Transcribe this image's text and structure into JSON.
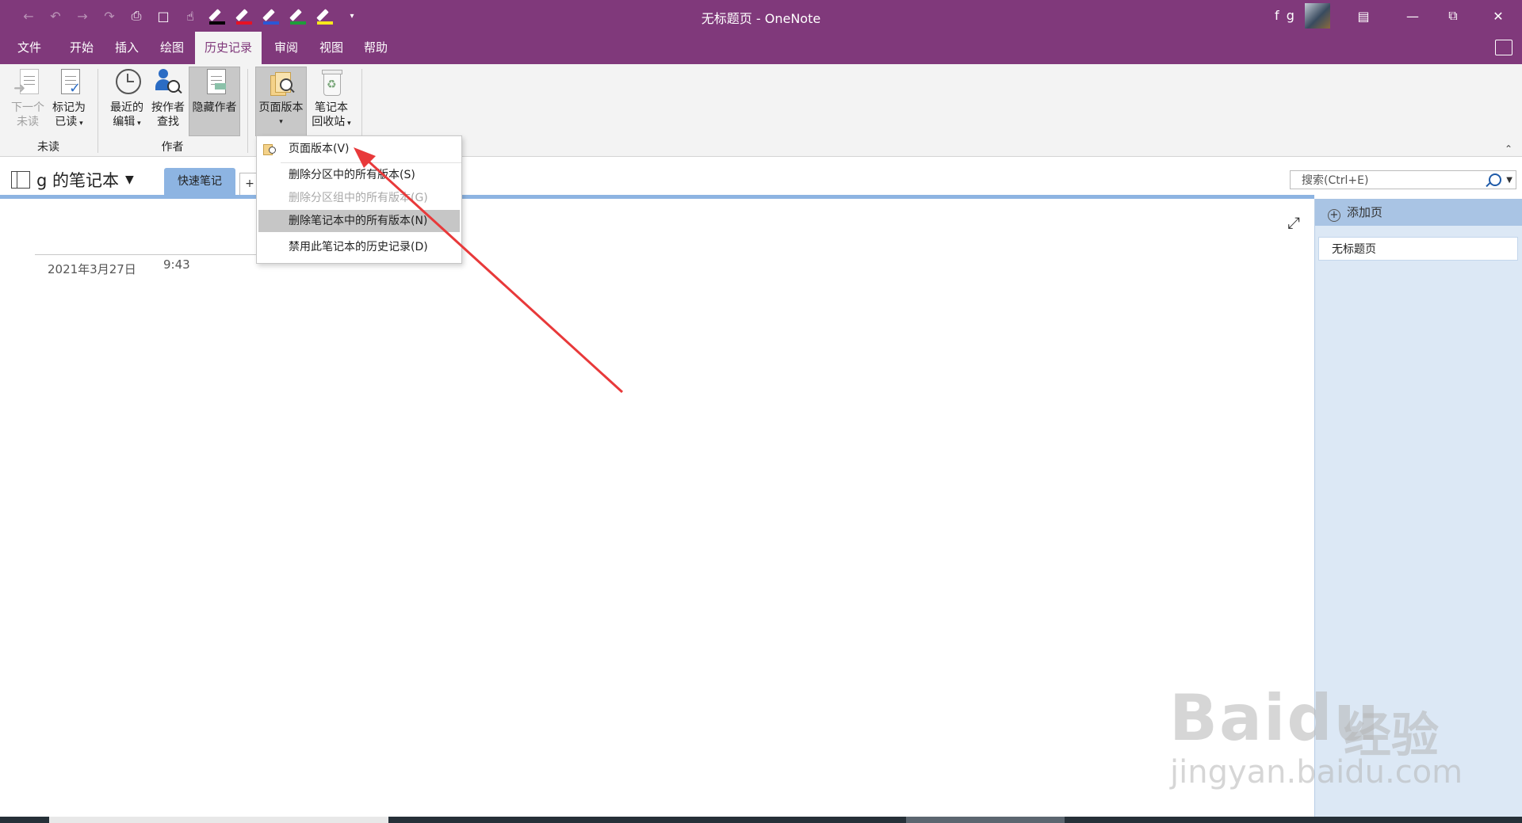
{
  "window": {
    "title": "无标题页 - OneNote",
    "user": "f g"
  },
  "ribbon_tabs": [
    "文件",
    "开始",
    "插入",
    "绘图",
    "历史记录",
    "审阅",
    "视图",
    "帮助"
  ],
  "active_tab": "历史记录",
  "ribbon": {
    "unread_group": "未读",
    "next_unread_line1": "下一个",
    "next_unread_line2": "未读",
    "mark_read_line1": "标记为",
    "mark_read_line2": "已读",
    "author_group": "作者",
    "recent_edits_line1": "最近的",
    "recent_edits_line2": "编辑",
    "find_by_author_line1": "按作者",
    "find_by_author_line2": "查找",
    "hide_authors": "隐藏作者",
    "page_versions": "页面版本",
    "recycle_line1": "笔记本",
    "recycle_line2": "回收站"
  },
  "notebook": {
    "name": "g 的笔记本",
    "section": "快速笔记",
    "add_section": "+"
  },
  "search": {
    "placeholder": "搜索(Ctrl+E)"
  },
  "page": {
    "date": "2021年3月27日",
    "time": "9:43"
  },
  "page_list": {
    "add_page": "添加页",
    "pages": [
      "无标题页"
    ]
  },
  "menu": {
    "items": [
      {
        "label": "页面版本(V)",
        "state": "normal"
      },
      {
        "label": "删除分区中的所有版本(S)",
        "state": "normal"
      },
      {
        "label": "删除分区组中的所有版本(G)",
        "state": "disabled"
      },
      {
        "label": "删除笔记本中的所有版本(N)",
        "state": "highlighted"
      },
      {
        "label": "禁用此笔记本的历史记录(D)",
        "state": "normal"
      }
    ]
  },
  "watermark": {
    "brand": "Bai",
    "brand2": "du",
    "cn": "经验",
    "url": "jingyan.baidu.com"
  },
  "colors": {
    "accent": "#80397b",
    "section_tab": "#8db4e2",
    "pen_colors": [
      "#000000",
      "#e81123",
      "#2b57d6",
      "#1e9c3a",
      "#f7e81c"
    ],
    "arrow": "#e8393a"
  }
}
